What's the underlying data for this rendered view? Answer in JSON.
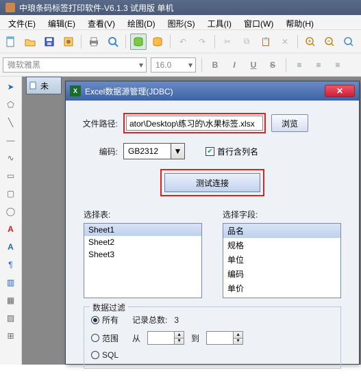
{
  "app": {
    "title": "中琅条码标签打印软件-V6.1.3 试用版 单机"
  },
  "menu": [
    "文件(E)",
    "编辑(E)",
    "查看(V)",
    "绘图(D)",
    "图形(S)",
    "工具(I)",
    "窗口(W)",
    "帮助(H)"
  ],
  "fontbar": {
    "font": "微软雅黑",
    "size": "16.0",
    "b": "B",
    "i": "I",
    "u": "U",
    "s": "S"
  },
  "doc": {
    "label": "未"
  },
  "dialog": {
    "title": "Excel数据源管理(JDBC)",
    "path_label": "文件路径:",
    "path_value": "ator\\Desktop\\练习的\\水果标签.xlsx",
    "browse": "浏览",
    "enc_label": "编码:",
    "enc_value": "GB2312",
    "firstrow": "首行含列名",
    "test": "测试连接",
    "sel_table": "选择表:",
    "sel_field": "选择字段:",
    "tables": [
      "Sheet1",
      "Sheet2",
      "Sheet3"
    ],
    "fields": [
      "品名",
      "规格",
      "单位",
      "编码",
      "单价"
    ],
    "filter": "数据过滤",
    "all": "所有",
    "range": "范围",
    "sql": "SQL",
    "count_lbl": "记录总数:",
    "count": "3",
    "from": "从",
    "to": "到"
  }
}
